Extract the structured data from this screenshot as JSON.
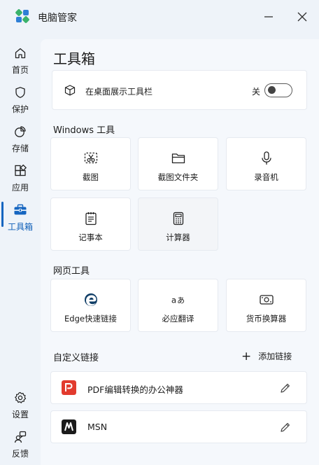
{
  "window": {
    "title": "电脑管家",
    "brand_colors": [
      "#3ab26b",
      "#2f7fd6"
    ]
  },
  "sidebar": {
    "items": [
      {
        "label": "首页",
        "icon": "home-icon"
      },
      {
        "label": "保护",
        "icon": "shield-icon"
      },
      {
        "label": "存储",
        "icon": "pie-chart-icon"
      },
      {
        "label": "应用",
        "icon": "apps-icon"
      },
      {
        "label": "工具箱",
        "icon": "toolbox-icon",
        "active": true
      }
    ],
    "bottom_items": [
      {
        "label": "设置",
        "icon": "gear-icon"
      },
      {
        "label": "反馈",
        "icon": "feedback-icon"
      }
    ],
    "accent_color": "#1565c0"
  },
  "main": {
    "title": "工具箱",
    "desktop_toggle": {
      "label": "在桌面展示工具栏",
      "state_label": "关",
      "on": false
    },
    "windows_tools": {
      "title": "Windows 工具",
      "tiles": [
        {
          "label": "截图",
          "icon": "screenshot-icon"
        },
        {
          "label": "截图文件夹",
          "icon": "folder-icon"
        },
        {
          "label": "录音机",
          "icon": "microphone-icon"
        },
        {
          "label": "记事本",
          "icon": "notepad-icon"
        },
        {
          "label": "计算器",
          "icon": "calculator-icon"
        }
      ]
    },
    "web_tools": {
      "title": "网页工具",
      "tiles": [
        {
          "label": "Edge快速链接",
          "icon": "edge-icon"
        },
        {
          "label": "必应翻译",
          "icon": "translate-icon"
        },
        {
          "label": "货币换算器",
          "icon": "currency-icon"
        }
      ]
    },
    "custom_links": {
      "title": "自定义链接",
      "add_label": "添加链接",
      "items": [
        {
          "label": "PDF编辑转换的办公神器",
          "icon": "pdf-app-icon"
        },
        {
          "label": "MSN",
          "icon": "msn-icon"
        }
      ]
    }
  }
}
